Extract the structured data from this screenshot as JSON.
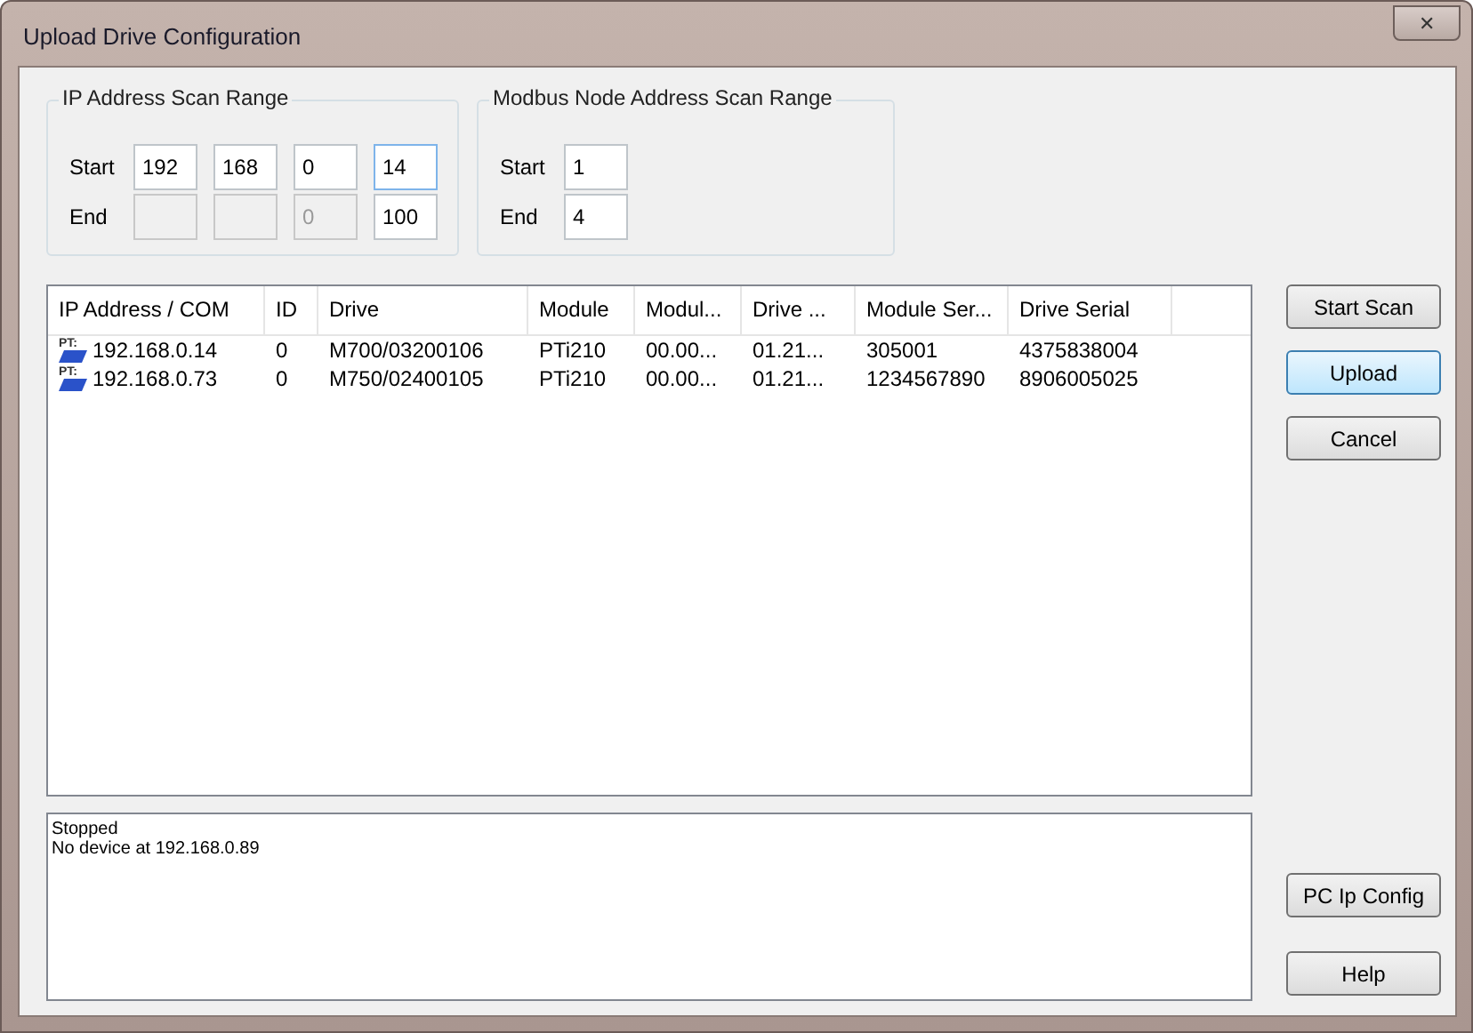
{
  "window": {
    "title": "Upload Drive Configuration",
    "close": "✕"
  },
  "ip_range": {
    "title": "IP Address Scan Range",
    "rows": [
      {
        "label": "Start",
        "fields": [
          {
            "value": "192",
            "disabled": false,
            "focused": false
          },
          {
            "value": "168",
            "disabled": false,
            "focused": false
          },
          {
            "value": "0",
            "disabled": false,
            "focused": false
          },
          {
            "value": "14",
            "disabled": false,
            "focused": true
          }
        ]
      },
      {
        "label": "End",
        "fields": [
          {
            "disabled": true,
            "focused": false
          },
          {
            "disabled": true,
            "focused": false
          },
          {
            "value": "0",
            "disabled": true,
            "focused": false
          },
          {
            "value": "100",
            "disabled": false,
            "focused": false
          }
        ]
      }
    ]
  },
  "modbus_range": {
    "title": "Modbus Node Address Scan Range",
    "rows": [
      {
        "label": "Start",
        "fields": [
          {
            "value": "1",
            "disabled": false,
            "focused": false
          }
        ]
      },
      {
        "label": "End",
        "fields": [
          {
            "value": "4",
            "disabled": false,
            "focused": false
          }
        ]
      }
    ]
  },
  "table": {
    "columns": [
      "IP Address / COM",
      "ID",
      "Drive",
      "Module",
      "Modul...",
      "Drive ...",
      "Module Ser...",
      "Drive Serial"
    ],
    "rows": [
      {
        "icon_label": "PT:",
        "cells": [
          "192.168.0.14",
          "0",
          "M700/03200106",
          "PTi210",
          "00.00...",
          "01.21...",
          "305001",
          "4375838004"
        ]
      },
      {
        "icon_label": "PT:",
        "cells": [
          "192.168.0.73",
          "0",
          "M750/02400105",
          "PTi210",
          "00.00...",
          "01.21...",
          "1234567890",
          "8906005025"
        ]
      }
    ]
  },
  "log": [
    "Stopped",
    "No device at 192.168.0.89"
  ],
  "buttons_top": [
    {
      "label": "Start Scan",
      "default": false
    },
    {
      "label": "Upload",
      "default": true
    },
    {
      "label": "Cancel",
      "default": false
    }
  ],
  "buttons_bottom": [
    {
      "label": "PC Ip Config",
      "default": false
    },
    {
      "label": "Help",
      "default": false
    }
  ]
}
